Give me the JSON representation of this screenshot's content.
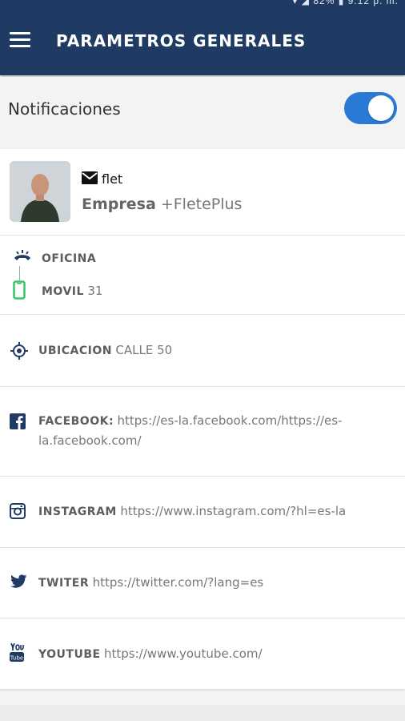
{
  "statusbar": {
    "text": "▾ ◢ 82% ▮ 9:12 p. m."
  },
  "appbar": {
    "title": "PARAMETROS GENERALES",
    "menu_icon": "hamburger-icon",
    "bg": "#1f3b63"
  },
  "notifications": {
    "label": "Notificaciones",
    "enabled": true,
    "accent": "#2b79d6"
  },
  "profile": {
    "email": "flet",
    "company_label": "Empresa",
    "company_value": "+FletePlus"
  },
  "contacts": {
    "oficina": {
      "label": "OFICINA",
      "value": ""
    },
    "movil": {
      "label": "MOVIL",
      "value": "31"
    },
    "ubicacion": {
      "label": "UBICACION",
      "value": "CALLE 50"
    },
    "facebook": {
      "label": "FACEBOOK:",
      "value_line1": "https://es-la.facebook.com/https://es-",
      "value_line2": "la.facebook.com/"
    },
    "instagram": {
      "label": "INSTAGRAM",
      "value": "https://www.instagram.com/?hl=es-la"
    },
    "twitter": {
      "label": "TWITER",
      "value": "https://twitter.com/?lang=es"
    },
    "youtube": {
      "label": "YOUTUBE",
      "value": "https://www.youtube.com/"
    }
  }
}
